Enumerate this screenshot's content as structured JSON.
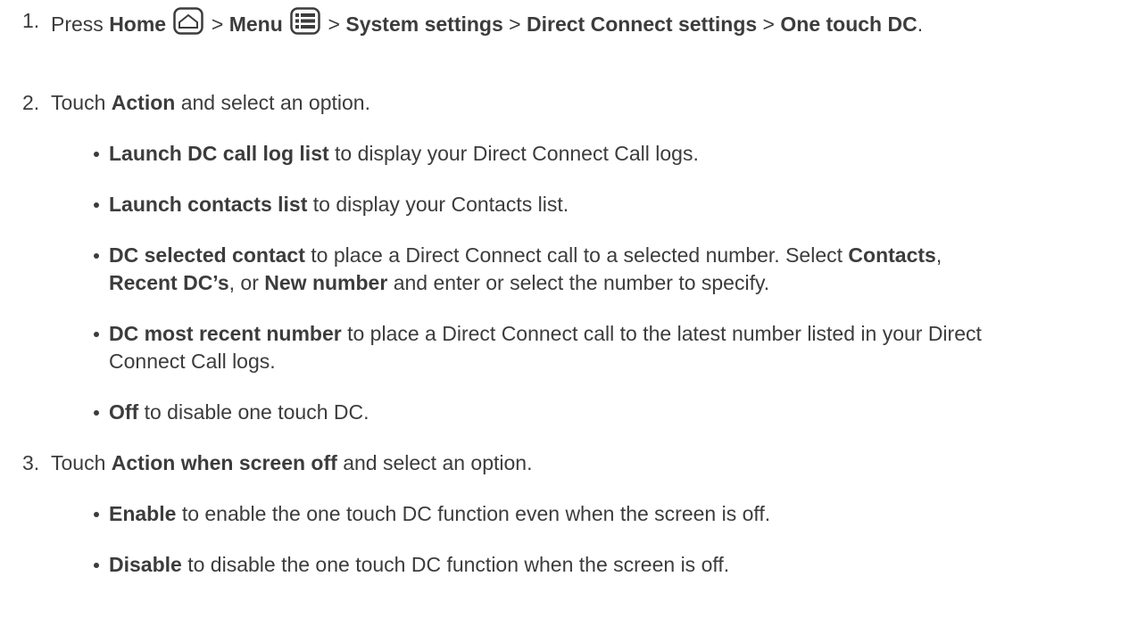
{
  "steps": [
    {
      "num": "1.",
      "press": "Press",
      "home": "Home",
      "sep1": ">",
      "menu": "Menu",
      "sep2": ">",
      "system_settings": "System settings",
      "sep3": ">",
      "dc_settings": "Direct Connect settings",
      "sep4": ">",
      "one_touch": "One touch DC",
      "end": "."
    },
    {
      "num": "2.",
      "pre": "Touch",
      "bold": "Action",
      "post": "and select an option."
    },
    {
      "num": "3.",
      "pre": "Touch",
      "bold": "Action when screen off",
      "post": "and select an option."
    }
  ],
  "bullets_action": [
    {
      "bold": "Launch DC call log list",
      "text": "to display your Direct Connect Call logs."
    },
    {
      "bold": "Launch contacts list",
      "text": "to display your Contacts list."
    },
    {
      "bold": "DC selected contact",
      "text": "to place a Direct Connect call to a selected number. Select",
      "contacts": "Contacts",
      "comma1": ",",
      "recent": "Recent DC’s",
      "or": ", or",
      "new_number": "New number",
      "text2": "and enter or select the number to specify."
    },
    {
      "bold": "DC most recent number",
      "text": "to place a Direct Connect call to the latest number listed in your Direct Connect Call logs."
    },
    {
      "bold": "Off",
      "text": "to disable one touch DC."
    }
  ],
  "bullets_screen_off": [
    {
      "bold": "Enable",
      "text": "to enable the one touch DC function even when the screen is off."
    },
    {
      "bold": "Disable",
      "text": "to disable the one touch DC function when the screen is off."
    }
  ],
  "icons": {
    "home": "home-icon",
    "menu": "menu-icon"
  }
}
